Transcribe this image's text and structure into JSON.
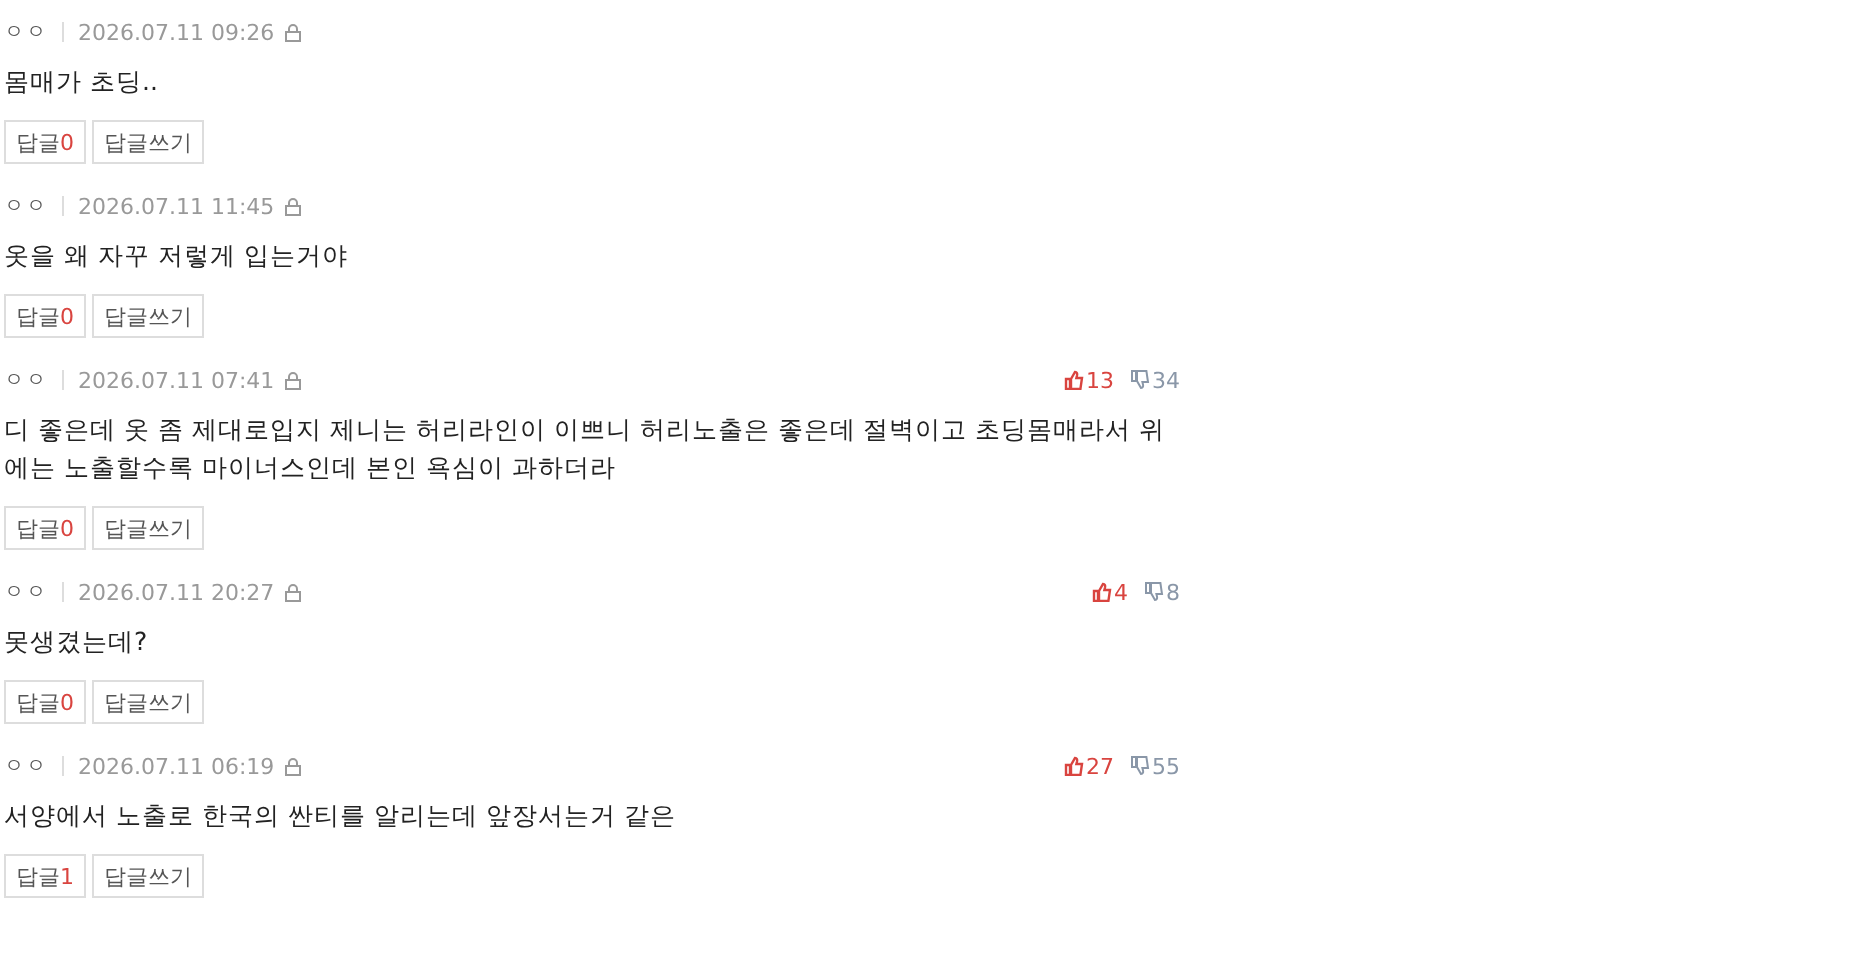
{
  "comments": [
    {
      "author": "ㅇㅇ",
      "date": "2026.07.11 09:26",
      "text": "몸매가 초딩..",
      "reply_label": "답글",
      "reply_count": "0",
      "write_label": "답글쓰기"
    },
    {
      "author": "ㅇㅇ",
      "date": "2026.07.11 11:45",
      "text": "옷을 왜 자꾸 저렇게 입는거야",
      "reply_label": "답글",
      "reply_count": "0",
      "write_label": "답글쓰기"
    },
    {
      "author": "ㅇㅇ",
      "date": "2026.07.11 07:41",
      "text": "디 좋은데 옷 좀 제대로입지 제니는 허리라인이 이쁘니 허리노출은 좋은데 절벽이고 초딩몸매라서 위에는 노출할수록 마이너스인데 본인 욕심이 과하더라",
      "reply_label": "답글",
      "reply_count": "0",
      "write_label": "답글쓰기",
      "likes": "13",
      "dislikes": "34"
    },
    {
      "author": "ㅇㅇ",
      "date": "2026.07.11 20:27",
      "text": "못생겼는데?",
      "reply_label": "답글",
      "reply_count": "0",
      "write_label": "답글쓰기",
      "likes": "4",
      "dislikes": "8"
    },
    {
      "author": "ㅇㅇ",
      "date": "2026.07.11 06:19",
      "text": "서양에서 노출로 한국의 싼티를 알리는데 앞장서는거 같은",
      "reply_label": "답글",
      "reply_count": "1",
      "write_label": "답글쓰기",
      "likes": "27",
      "dislikes": "55"
    }
  ]
}
